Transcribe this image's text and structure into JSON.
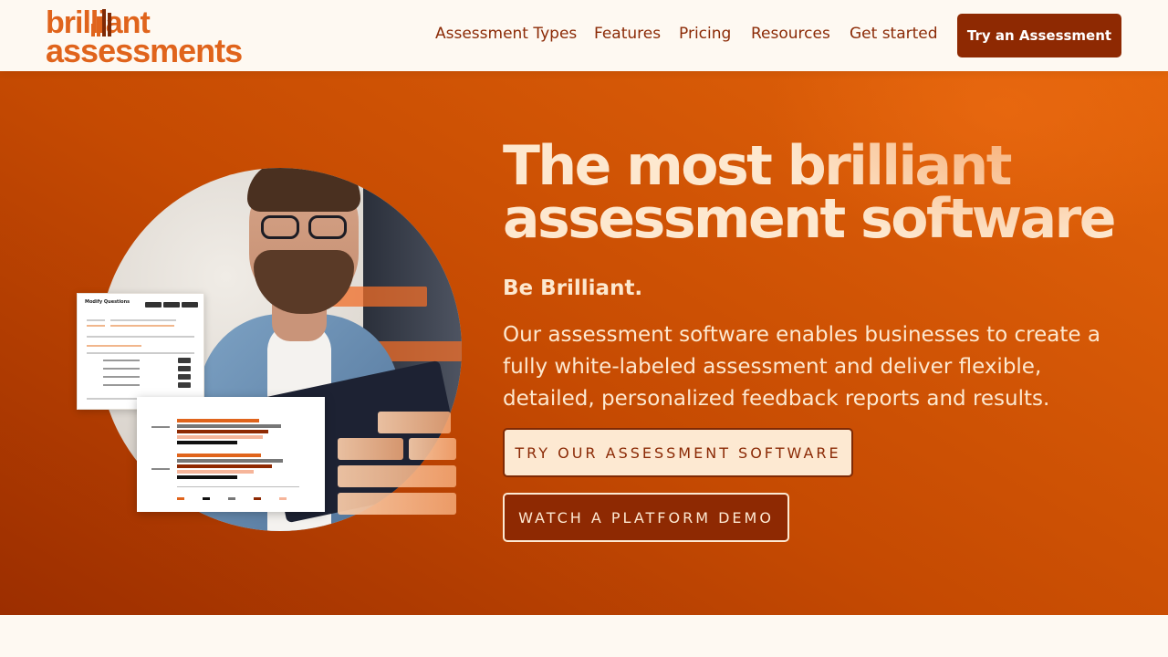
{
  "brand": {
    "logo_line1": "brilliant",
    "logo_line2": "assessments",
    "color": "#e0641c"
  },
  "nav": {
    "items": [
      {
        "label": "Assessment Types"
      },
      {
        "label": "Features"
      },
      {
        "label": "Pricing"
      },
      {
        "label": "Resources"
      },
      {
        "label": "Get started"
      }
    ],
    "cta_label": "Try an Assessment"
  },
  "hero": {
    "headline_line1": "The most brilliant",
    "headline_line2": "assessment software",
    "subheading": "Be Brilliant.",
    "description": "Our assessment software enables businesses to create a fully white-labeled assessment and deliver flexible, detailed, personalized feedback reports and results.",
    "primary_button": "TRY OUR ASSESSMENT SOFTWARE",
    "secondary_button": "WATCH A PLATFORM DEMO"
  },
  "card_modify": {
    "title": "Modify Questions"
  },
  "colors": {
    "accent": "#e0641c",
    "dark_brand": "#8e2902",
    "cream": "#fde8cf",
    "page_bg": "#fef9f2"
  }
}
